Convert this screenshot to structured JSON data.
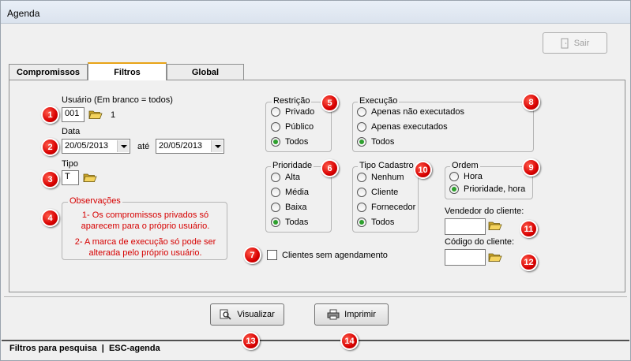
{
  "window": {
    "title": "Agenda"
  },
  "toolbar": {
    "sair_label": "Sair"
  },
  "tabs": [
    {
      "label": "Compromissos"
    },
    {
      "label": "Filtros"
    },
    {
      "label": "Global"
    }
  ],
  "filtros": {
    "usuario": {
      "label": "Usuário (Em branco = todos)",
      "value": "001",
      "resolved": "1"
    },
    "data": {
      "label": "Data",
      "from": "20/05/2013",
      "connector": "até",
      "to": "20/05/2013"
    },
    "tipo": {
      "label": "Tipo",
      "value": "T"
    },
    "observacoes": {
      "title": "Observações",
      "note1": "1- Os compromissos privados só aparecem para o próprio usuário.",
      "note2": "2- A marca de execução só pode ser alterada pelo próprio usuário."
    },
    "restricao": {
      "title": "Restrição",
      "options": [
        "Privado",
        "Público",
        "Todos"
      ],
      "selected": "Todos"
    },
    "execucao": {
      "title": "Execução",
      "options": [
        "Apenas não executados",
        "Apenas executados",
        "Todos"
      ],
      "selected": "Todos"
    },
    "prioridade": {
      "title": "Prioridade",
      "options": [
        "Alta",
        "Média",
        "Baixa",
        "Todas"
      ],
      "selected": "Todas"
    },
    "tipo_cadastro": {
      "title": "Tipo Cadastro",
      "options": [
        "Nenhum",
        "Cliente",
        "Fornecedor",
        "Todos"
      ],
      "selected": "Todos"
    },
    "ordem": {
      "title": "Ordem",
      "options": [
        "Hora",
        "Prioridade, hora"
      ],
      "selected": "Prioridade, hora"
    },
    "clientes_sem_agendamento": {
      "label": "Clientes sem agendamento",
      "checked": false
    },
    "vendedor": {
      "label": "Vendedor do cliente:",
      "value": ""
    },
    "codigo": {
      "label": "Código do cliente:",
      "value": ""
    }
  },
  "buttons": {
    "visualizar": "Visualizar",
    "imprimir": "Imprimir"
  },
  "status": {
    "text": "Filtros para pesquisa  |  ESC-agenda"
  },
  "badges": [
    "1",
    "2",
    "3",
    "4",
    "5",
    "6",
    "7",
    "8",
    "9",
    "10",
    "11",
    "12",
    "13",
    "14"
  ],
  "colors": {
    "badge": "#d80000",
    "observacoes_text": "#d60000",
    "active_tab_accent": "#e8a317",
    "radio_selected": "#2ea02e"
  }
}
